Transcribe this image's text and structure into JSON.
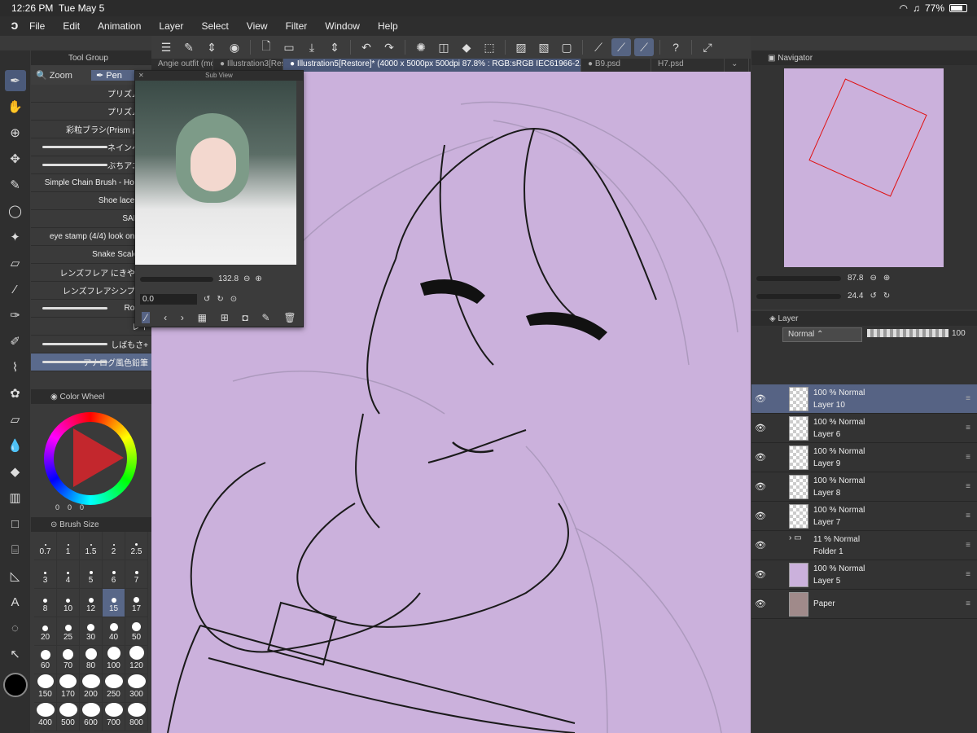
{
  "status": {
    "time": "12:26 PM",
    "date": "Tue May 5",
    "battery": "77%"
  },
  "menu": [
    "File",
    "Edit",
    "Animation",
    "Layer",
    "Select",
    "View",
    "Filter",
    "Window",
    "Help"
  ],
  "tabs": [
    {
      "label": "Angie outfit (mo",
      "active": false
    },
    {
      "label": "● Illustration3[Res",
      "active": false
    },
    {
      "label": "● Illustration5[Restore]* (4000 x 5000px 500dpi 87.8% : RGB:sRGB IEC61966-2.1)",
      "active": true
    },
    {
      "label": "● B9.psd",
      "active": false
    },
    {
      "label": "H7.psd",
      "active": false
    }
  ],
  "toolgroup": {
    "title": "Tool Group",
    "subtabs": [
      "Zoom",
      "Pen"
    ],
    "brushes": [
      "プリズムペ",
      "プリズムペ",
      "彩粒ブラシ(Prism parti",
      "ネインペン",
      "ぶちアニメ",
      "Simple Chain Brush - Hollow",
      "Shoe laces br",
      "SAN_L",
      "eye stamp (4/4) look on pfp",
      "Snake Scale Br",
      "レンズフレア にきやか (",
      "レンズフレアシンプル (",
      "Rough",
      "レイ",
      "しばもさ+",
      "アナログ風色鉛筆"
    ]
  },
  "colorwheel": {
    "title": "Color Wheel",
    "r": "0",
    "g": "0",
    "b": "0",
    "accent": "#c3272d"
  },
  "brushsize": {
    "title": "Brush Size",
    "sizes": [
      "0.7",
      "1",
      "1.5",
      "2",
      "2.5",
      "3",
      "4",
      "5",
      "6",
      "7",
      "8",
      "10",
      "12",
      "15",
      "17",
      "20",
      "25",
      "30",
      "40",
      "50",
      "60",
      "70",
      "80",
      "100",
      "120",
      "150",
      "170",
      "200",
      "250",
      "300",
      "400",
      "500",
      "600",
      "700",
      "800"
    ],
    "selected": "15"
  },
  "subview": {
    "title": "Sub View",
    "zoom": "132.8",
    "angle": "0.0"
  },
  "navigator": {
    "title": "Navigator",
    "zoom": "87.8",
    "angle": "24.4"
  },
  "layers": {
    "title": "Layer",
    "blend": "Normal",
    "opacity": "100",
    "rows": [
      {
        "opacity": "100 % Normal",
        "name": "Layer 10",
        "selected": true
      },
      {
        "opacity": "100 % Normal",
        "name": "Layer 6",
        "selected": false
      },
      {
        "opacity": "100 % Normal",
        "name": "Layer 9",
        "selected": false
      },
      {
        "opacity": "100 % Normal",
        "name": "Layer 8",
        "selected": false
      },
      {
        "opacity": "100 % Normal",
        "name": "Layer 7",
        "selected": false
      },
      {
        "opacity": "11 % Normal",
        "name": "Folder 1",
        "selected": false
      },
      {
        "opacity": "100 % Normal",
        "name": "Layer 5",
        "selected": false
      },
      {
        "opacity": "",
        "name": "Paper",
        "selected": false
      }
    ]
  },
  "colors": {
    "canvas": "#cbb1dc",
    "selection": "#566384",
    "paper": "#a08a8a",
    "layer5": "#cbb1dc"
  }
}
